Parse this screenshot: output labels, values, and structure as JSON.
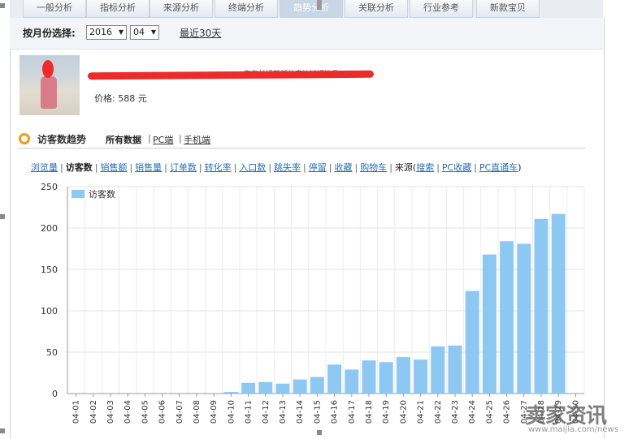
{
  "tabs": [
    {
      "label": "一般分析",
      "active": false
    },
    {
      "label": "指标分析",
      "active": false
    },
    {
      "label": "来源分析",
      "active": false
    },
    {
      "label": "终端分析",
      "active": false
    },
    {
      "label": "趋势分析",
      "active": true
    },
    {
      "label": "关联分析",
      "active": false
    },
    {
      "label": "行业参考",
      "active": false
    },
    {
      "label": "新款宝贝",
      "active": false
    }
  ],
  "month_select": {
    "label": "按月份选择:",
    "year": "2016",
    "month": "04",
    "recent_link": "最近30天"
  },
  "product": {
    "title_tail": "东东长裙新版热卖沙滩裙饰品",
    "price": "价格: 588 元"
  },
  "section": {
    "title": "访客数趋势",
    "scopes": [
      "所有数据",
      "PC端",
      "手机端"
    ]
  },
  "metrics": {
    "items": [
      "浏览量",
      "访客数",
      "销售额",
      "销售量",
      "订单数",
      "转化率",
      "入口数",
      "跳失率",
      "停留",
      "收藏",
      "购物车"
    ],
    "active": "访客数",
    "source_label": "来源(",
    "sources": [
      "搜索",
      "PC收藏",
      "PC直通车"
    ],
    "close": ")"
  },
  "chart_data": {
    "type": "bar",
    "series": [
      {
        "name": "访客数",
        "color": "#8cc8f2"
      }
    ],
    "categories": [
      "04-01",
      "04-02",
      "04-03",
      "04-04",
      "04-05",
      "04-06",
      "04-07",
      "04-08",
      "04-09",
      "04-10",
      "04-11",
      "04-12",
      "04-13",
      "04-14",
      "04-15",
      "04-16",
      "04-17",
      "04-18",
      "04-19",
      "04-20",
      "04-21",
      "04-22",
      "04-23",
      "04-24",
      "04-25",
      "04-26",
      "04-27",
      "04-28",
      "04-29",
      "04-30"
    ],
    "values": [
      0,
      0,
      0,
      0,
      0,
      0,
      0,
      0,
      0,
      2,
      13,
      14,
      12,
      17,
      20,
      35,
      29,
      40,
      38,
      44,
      41,
      57,
      58,
      124,
      168,
      184,
      181,
      211,
      217,
      0
    ],
    "ylim": [
      0,
      250
    ],
    "yticks": [
      "0",
      "50",
      "100",
      "150",
      "200",
      "250"
    ],
    "grid": true,
    "legend_position": "top-left"
  },
  "watermark": {
    "text": "卖家资讯",
    "url": "www.maijia.com/news"
  }
}
